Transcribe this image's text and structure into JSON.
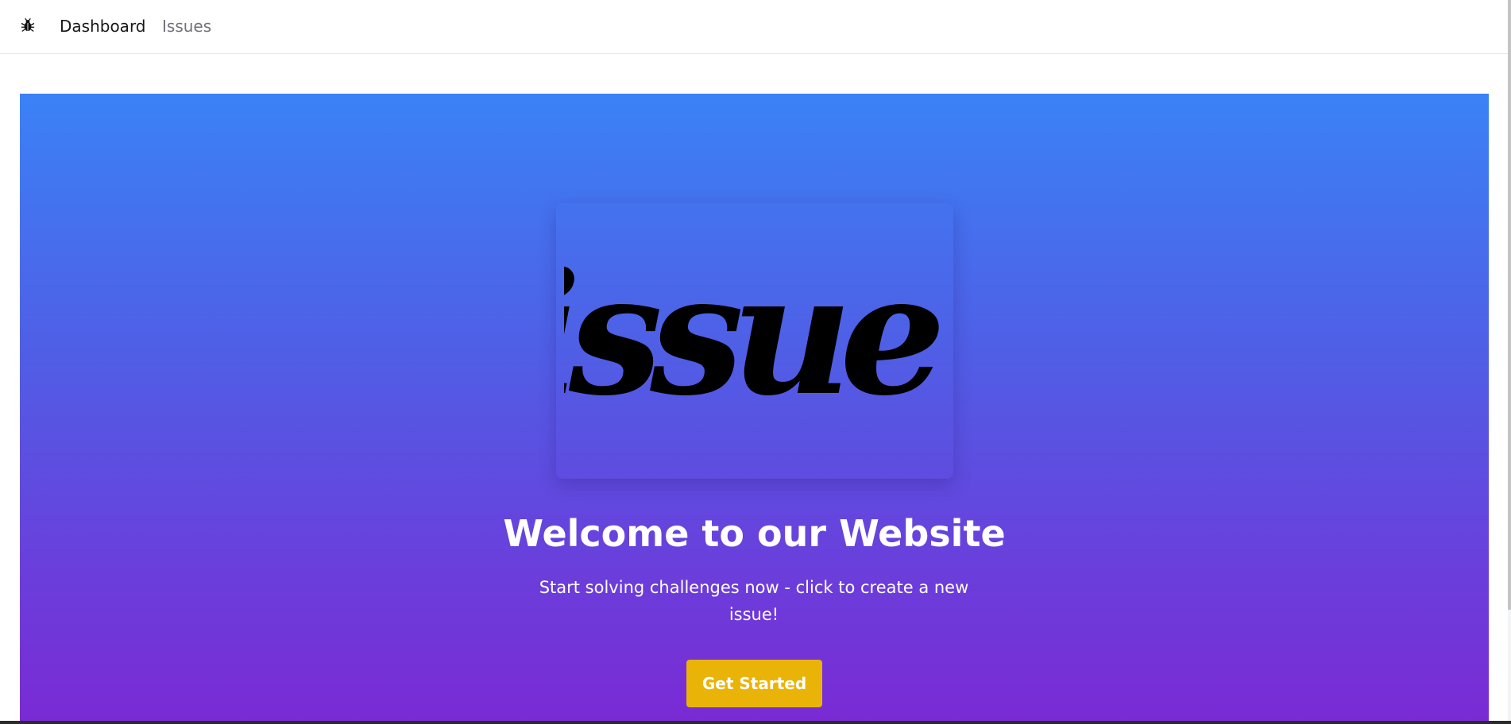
{
  "nav": {
    "logo_icon": "bug-icon",
    "links": [
      {
        "label": "Dashboard",
        "active": true
      },
      {
        "label": "Issues",
        "active": false
      }
    ]
  },
  "hero": {
    "logo_text": "issue.",
    "title": "Welcome to our Website",
    "subtitle": "Start solving challenges now - click to create a new issue!",
    "cta_label": "Get Started",
    "gradient_top": "#3b82f6",
    "gradient_bottom": "#7a2ad4",
    "cta_color": "#eab308"
  }
}
